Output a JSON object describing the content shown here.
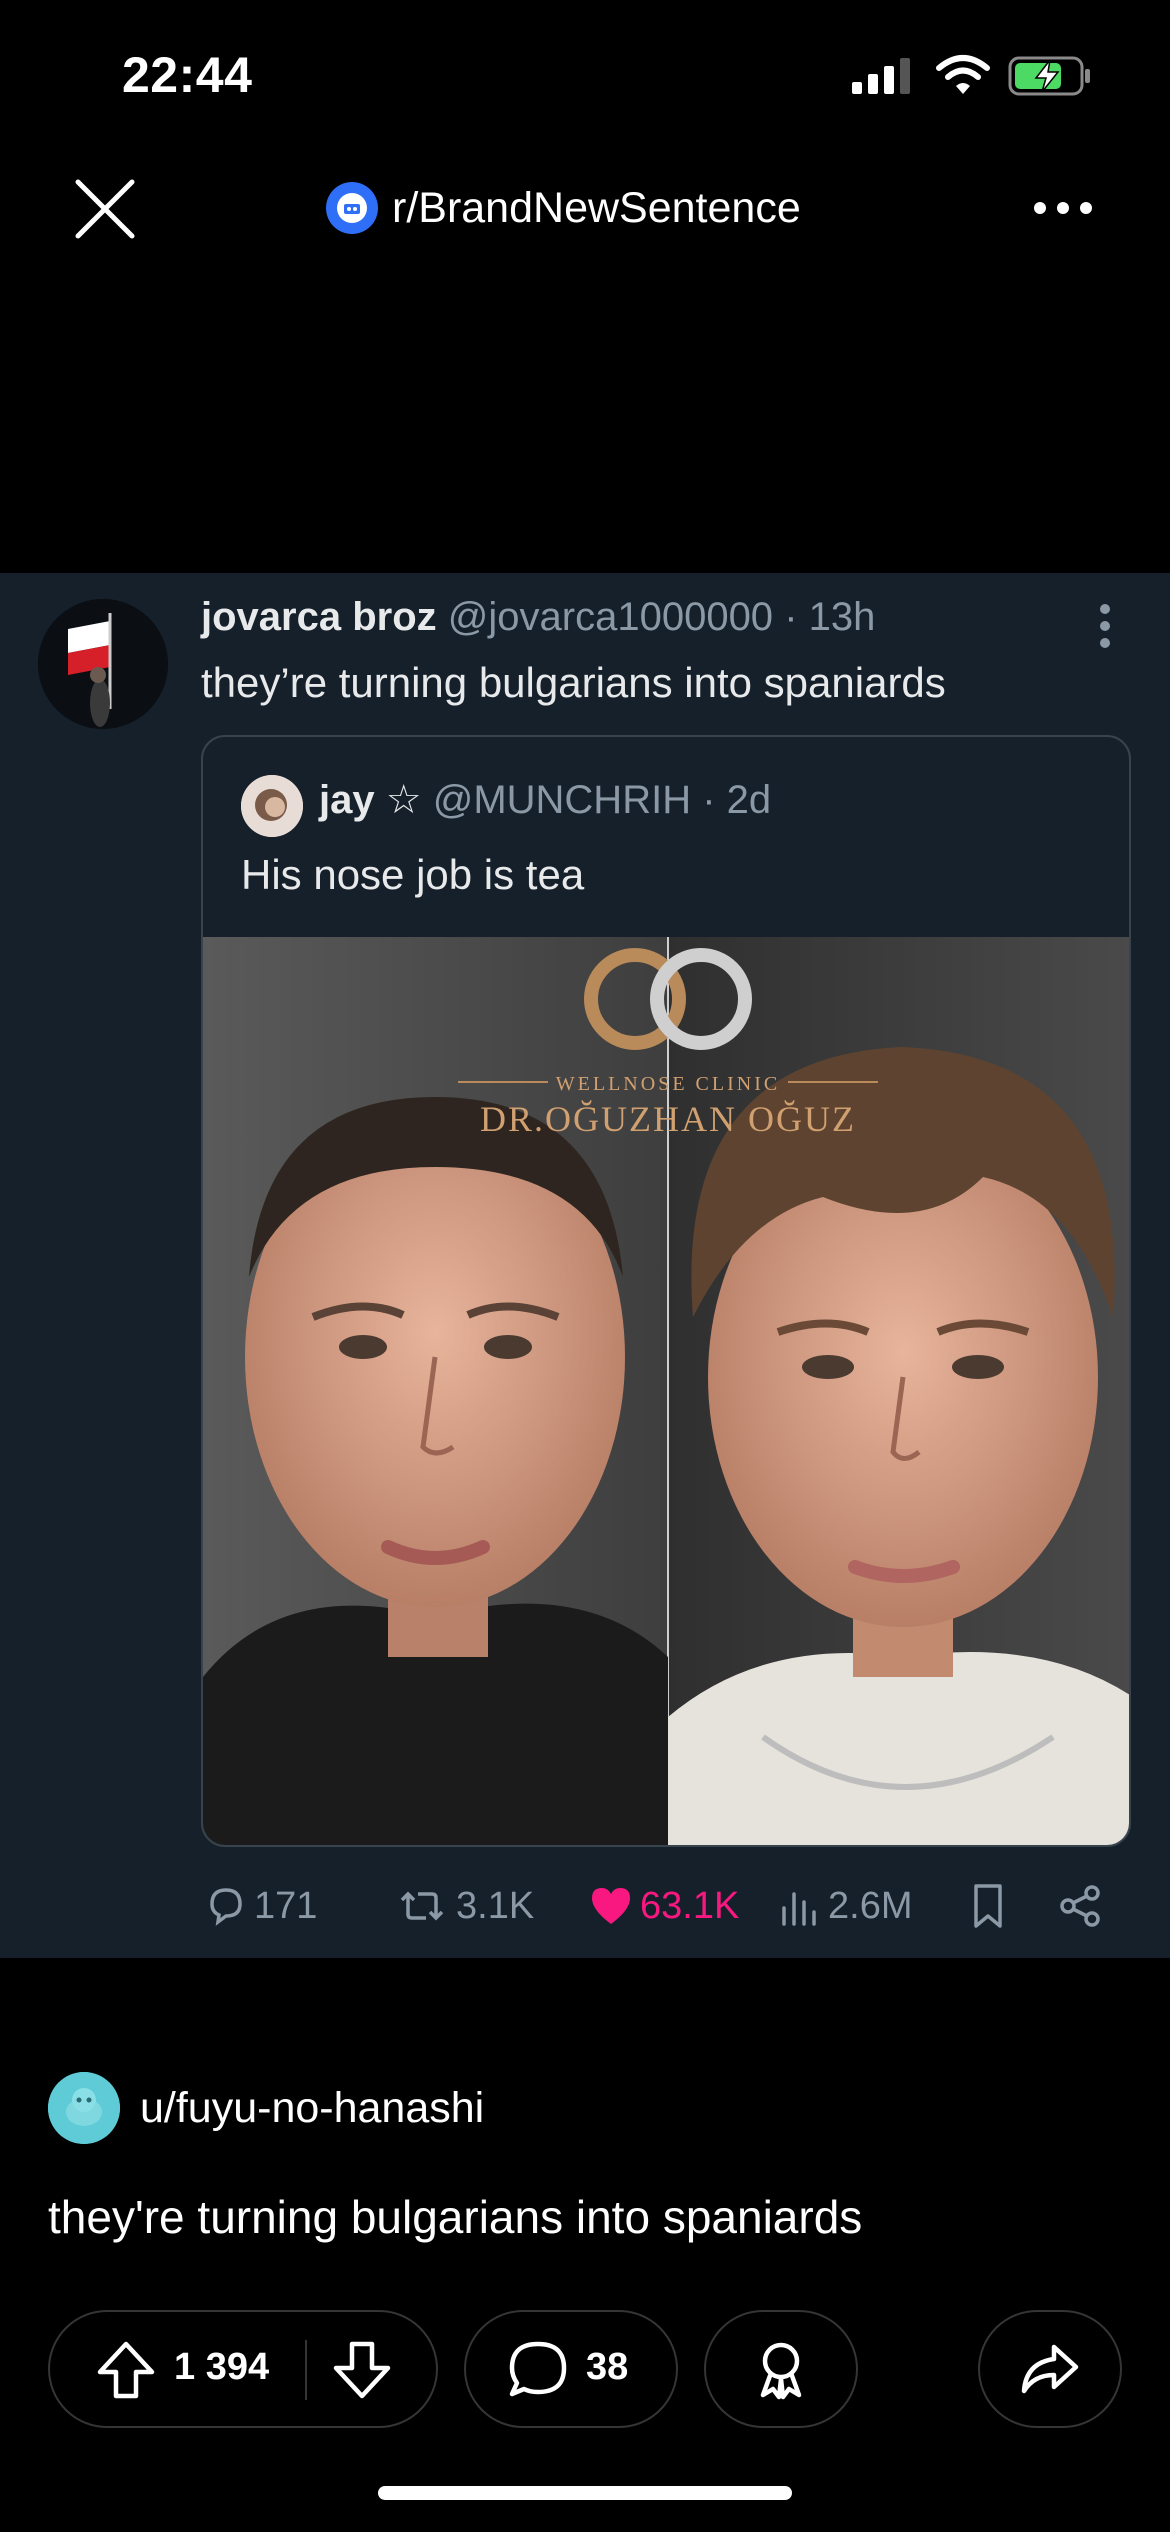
{
  "status_bar": {
    "time": "22:44"
  },
  "nav": {
    "subreddit": "r/BrandNewSentence"
  },
  "tweet": {
    "name": "jovarca broz",
    "handle": "@jovarca1000000",
    "age": "· 13h",
    "text": "they’re turning bulgarians into spaniards",
    "quote": {
      "name": "jay",
      "star": "☆",
      "handle": "@MUNCHRIH",
      "age": "· 2d",
      "text": "His nose job is tea",
      "image_watermark_line1": "WELLNOSE CLINIC",
      "image_watermark_line2": "DR.OĞUZHAN OĞUZ"
    },
    "actions": {
      "replies": "171",
      "retweets": "3.1K",
      "likes": "63.1K",
      "views": "2.6M"
    },
    "like_color": "#f91880"
  },
  "post": {
    "author": "u/fuyu-no-hanashi",
    "title": "they're turning bulgarians into spaniards",
    "votes": "1 394",
    "comments": "38"
  },
  "colors": {
    "tweet_bg": "#15202b",
    "accent_blue": "#2f6ff7",
    "avatar_teal": "#5ecbd6"
  }
}
